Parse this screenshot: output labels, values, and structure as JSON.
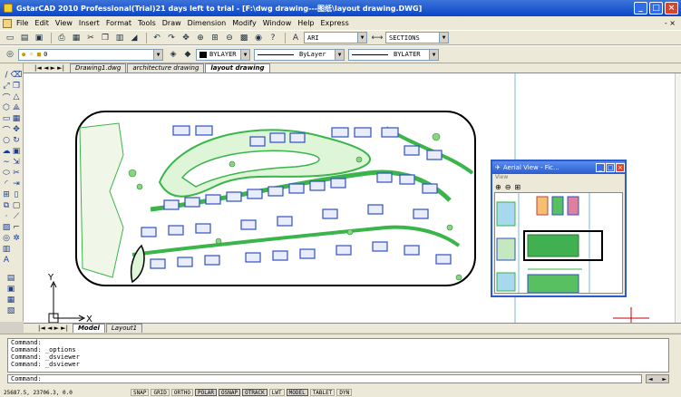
{
  "titlebar": {
    "title": "GstarCAD 2010 Professional(Trial)21 days left to trial - [F:\\dwg drawing---图纸\\layout drawing.DWG]",
    "buttons": [
      "_",
      "□",
      "×"
    ]
  },
  "menubar": {
    "items": [
      "File",
      "Edit",
      "View",
      "Insert",
      "Format",
      "Tools",
      "Draw",
      "Dimension",
      "Modify",
      "Window",
      "Help",
      "Express"
    ],
    "right_controls": "- ×"
  },
  "toolbar1": {
    "text_style_value": "ARI",
    "dim_style_value": "SECTIONS"
  },
  "toolbar2": {
    "layer_value": "0",
    "color_value": "BYLAYER",
    "linetype_value": "ByLayer",
    "lineweight_value": "BYLATER"
  },
  "tabs": {
    "nav": "|◄ ◄ ► ►|",
    "items": [
      "Drawing1.dwg",
      "architecture drawing",
      "layout drawing"
    ],
    "active_index": 2
  },
  "model_tabs": {
    "nav": "|◄ ◄ ► ►|",
    "items": [
      "Model",
      "Layout1"
    ],
    "active_index": 0
  },
  "ucs": {
    "x_label": "X",
    "y_label": "Y"
  },
  "aerial_view": {
    "title": "Aerial View - Fic...",
    "menu": "View",
    "tools": [
      "zoom-in",
      "zoom-out",
      "zoom-all"
    ]
  },
  "command": {
    "history": [
      "Command:",
      "Command: _options",
      "Command: _dsviewer",
      "Command: _dsviewer"
    ],
    "prompt": "Command:"
  },
  "status": {
    "coords": "25687.5, 23706.3, 0.0",
    "buttons": [
      {
        "label": "SNAP",
        "on": false
      },
      {
        "label": "GRID",
        "on": false
      },
      {
        "label": "ORTHO",
        "on": false
      },
      {
        "label": "POLAR",
        "on": true
      },
      {
        "label": "OSNAP",
        "on": true
      },
      {
        "label": "OTRACK",
        "on": true
      },
      {
        "label": "LWT",
        "on": false
      },
      {
        "label": "MODEL",
        "on": true
      },
      {
        "label": "TABLET",
        "on": false
      },
      {
        "label": "DYN",
        "on": false
      }
    ]
  },
  "colors": {
    "titlebar": "#0a46c8",
    "drawing_outline": "#000000",
    "greenery": "#39b54a",
    "buildings": "#3050c0",
    "crosshair": "#c00000"
  }
}
